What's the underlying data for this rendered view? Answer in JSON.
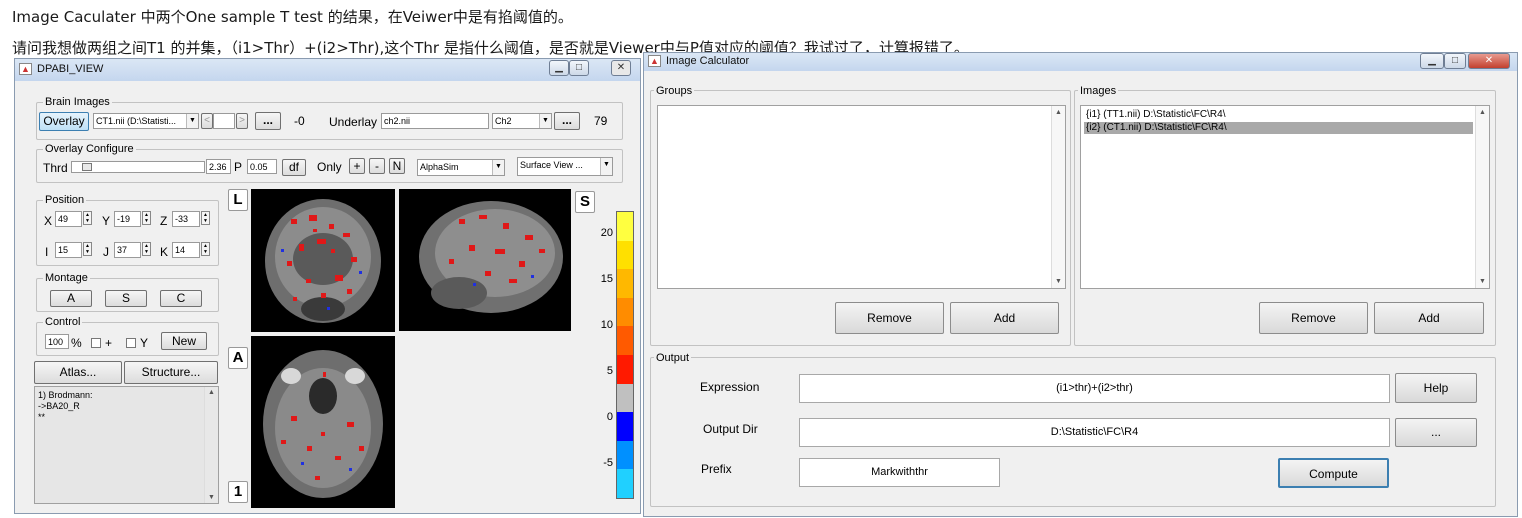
{
  "post": {
    "line1": "Image Caculater 中两个One sample T test 的结果，在Veiwer中是有掐阈值的。",
    "line2": "请问我想做两组之间T1 的并集，（i1>Thr）+(i2>Thr),这个Thr 是指什么阈值，是否就是Viewer中与P值对应的阈值？我试过了，计算报错了。"
  },
  "dpabi": {
    "title": "DPABI_VIEW",
    "brain_images": {
      "group_title": "Brain Images",
      "overlay_button": "Overlay",
      "overlay_file": "CT1.nii (D:\\Statisti...",
      "prev": "<",
      "next": ">",
      "more": "...",
      "value": "-0",
      "underlay_label": "Underlay",
      "underlay_file": "ch2.nii",
      "underlay_combo": "Ch2",
      "underlay_more": "...",
      "underlay_value": "79"
    },
    "overlay_configure": {
      "group_title": "Overlay Configure",
      "thrd_label": "Thrd",
      "thrd_value": "2.36",
      "p_label": "P",
      "p_value": "0.05",
      "df_button": "df",
      "only_label": "Only",
      "plus": "+",
      "minus": "-",
      "n_button": "N",
      "alphasim": "AlphaSim",
      "surface_view": "Surface View ..."
    },
    "position": {
      "group_title": "Position",
      "x_label": "X",
      "x_value": "49",
      "y_label": "Y",
      "y_value": "-19",
      "z_label": "Z",
      "z_value": "-33",
      "i_label": "I",
      "i_value": "15",
      "j_label": "J",
      "j_value": "37",
      "k_label": "K",
      "k_value": "14"
    },
    "montage": {
      "group_title": "Montage",
      "a": "A",
      "s": "S",
      "c": "C"
    },
    "control": {
      "group_title": "Control",
      "percent_value": "100",
      "percent_label": "%",
      "plus_label": "+",
      "y_label": "Y",
      "new_button": "New"
    },
    "atlas_button": "Atlas...",
    "structure_button": "Structure...",
    "info_lines": [
      "1) Brodmann:",
      "->BA20_R",
      "**"
    ],
    "views": {
      "l": "L",
      "s": "S",
      "a": "A",
      "num": "1"
    },
    "colorbar": {
      "ticks": [
        "20",
        "15",
        "10",
        "5",
        "0",
        "-5"
      ],
      "colors": [
        "#ffff40",
        "#ffe000",
        "#ffb800",
        "#ff8c00",
        "#ff5a00",
        "#ff1a00",
        "#c0c0c0",
        "#0000ff",
        "#0090ff",
        "#20d0ff"
      ]
    }
  },
  "calc": {
    "title": "Image Calculator",
    "groups_label": "Groups",
    "images_label": "Images",
    "images": [
      "{i1} (TT1.nii) D:\\Statistic\\FC\\R4\\",
      "{i2} (CT1.nii) D:\\Statistic\\FC\\R4\\"
    ],
    "remove": "Remove",
    "add": "Add",
    "output_label": "Output",
    "expression_label": "Expression",
    "expression_value": "(i1>thr)+(i2>thr)",
    "help_button": "Help",
    "outdir_label": "Output Dir",
    "outdir_value": "D:\\Statistic\\FC\\R4",
    "browse_button": "...",
    "prefix_label": "Prefix",
    "prefix_value": "Markwiththr",
    "compute_button": "Compute"
  }
}
